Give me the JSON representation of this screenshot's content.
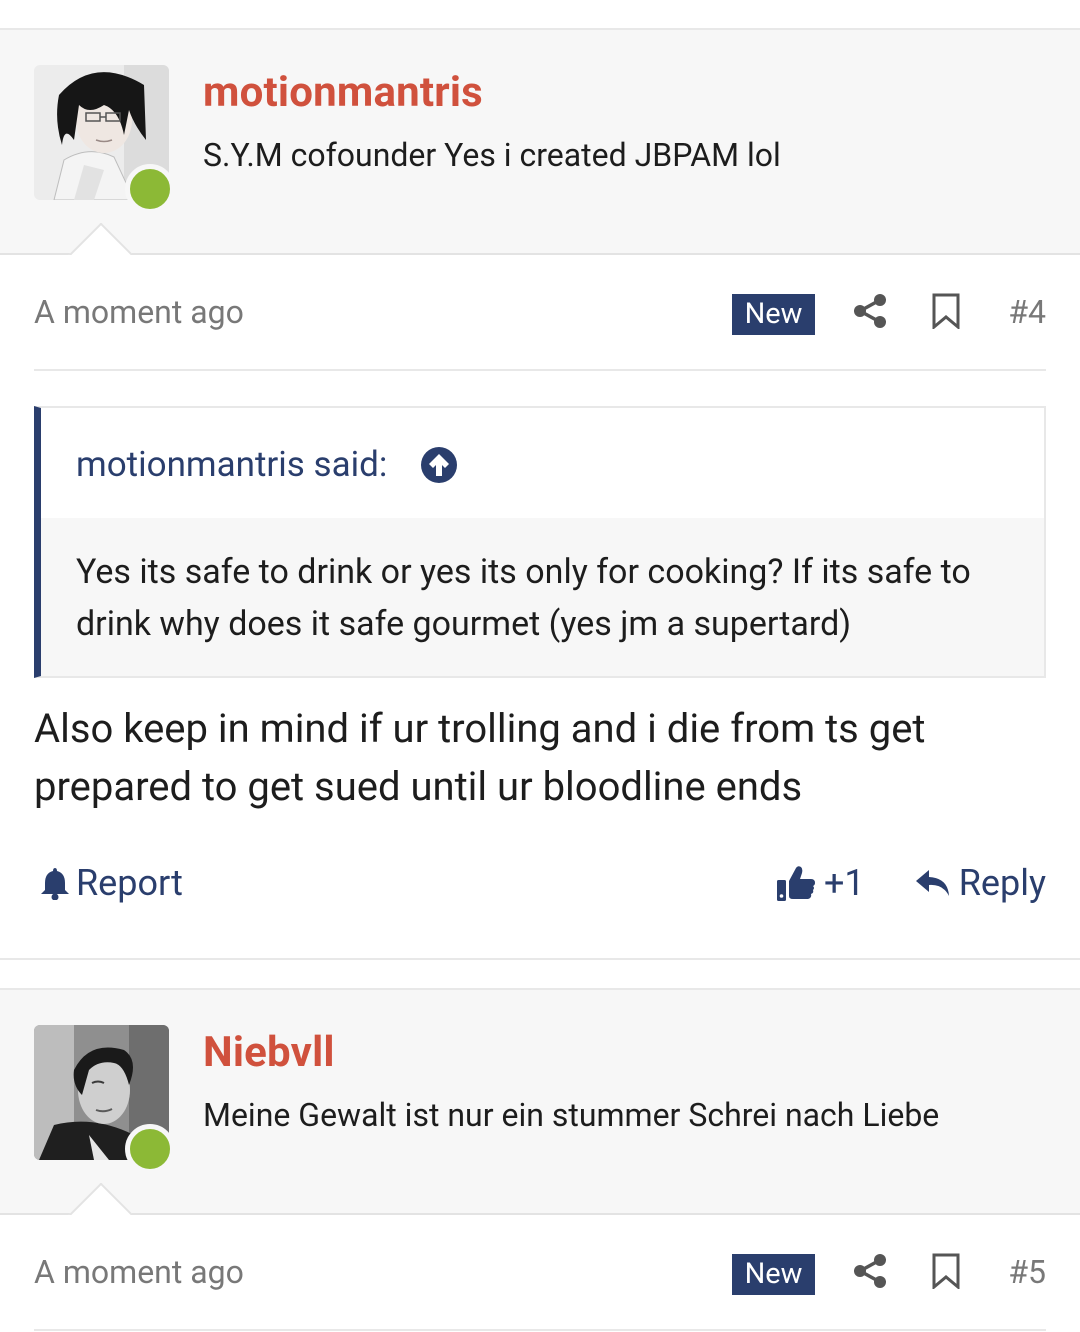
{
  "posts": [
    {
      "username": "motionmantris",
      "user_title": "S.Y.M cofounder Yes i created JBPAM lol",
      "timestamp": "A moment ago",
      "badge": "New",
      "post_number": "#4",
      "quote": {
        "author": "motionmantris said:",
        "text": "Yes its safe to drink or yes its only for cooking? If its safe to drink why does it safe gourmet (yes jm a supertard)"
      },
      "message": "Also keep in mind if ur trolling and i die from ts get prepared to get sued until ur bloodline ends",
      "actions": {
        "report": "Report",
        "like_count": "+1",
        "reply": "Reply"
      }
    },
    {
      "username": "Niebvll",
      "user_title": "Meine Gewalt ist nur ein stummer Schrei nach Liebe",
      "timestamp": "A moment ago",
      "badge": "New",
      "post_number": "#5"
    }
  ],
  "icons": {
    "share": "share-icon",
    "bookmark": "bookmark-icon",
    "quote_jump": "arrow-circle-up-icon",
    "report": "bell-icon",
    "like": "thumbs-up-icon",
    "reply": "reply-arrow-icon"
  },
  "colors": {
    "username": "#d0513d",
    "accent": "#2a3e6d",
    "online": "#8cb936",
    "muted": "#787878"
  }
}
